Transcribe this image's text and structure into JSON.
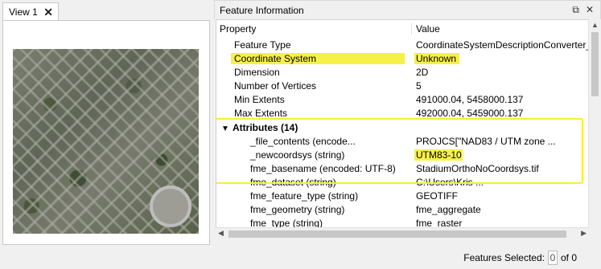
{
  "view": {
    "tab_label": "View 1",
    "close_glyph": "✕"
  },
  "feature_info": {
    "title": "Feature Information",
    "header_buttons": [
      "⧉",
      "✕"
    ],
    "columns": {
      "property": "Property",
      "value": "Value"
    },
    "rows": [
      {
        "property": "Feature Type",
        "value": "CoordinateSystemDescriptionConverter_"
      },
      {
        "property": "Coordinate System",
        "value": "Unknown"
      },
      {
        "property": "Dimension",
        "value": "2D"
      },
      {
        "property": "Number of Vertices",
        "value": "5"
      },
      {
        "property": "Min Extents",
        "value": "491000.04, 5458000.137"
      },
      {
        "property": "Max Extents",
        "value": "492000.04, 5459000.137"
      },
      {
        "property": "Attributes (14)",
        "value": ""
      },
      {
        "property": "_file_contents (encode...",
        "value": "PROJCS[\"NAD83 / UTM zone ..."
      },
      {
        "property": "_newcoordsys (string)",
        "value": "UTM83-10"
      },
      {
        "property": "fme_basename (encoded: UTF-8)",
        "value": "StadiumOrthoNoCoordsys.tif"
      },
      {
        "property": "fme_dataset (string)",
        "value": "C:\\Users\\Kris ..."
      },
      {
        "property": "fme_feature_type (string)",
        "value": "GEOTIFF"
      },
      {
        "property": "fme_geometry (string)",
        "value": "fme_aggregate"
      },
      {
        "property": "fme_type (string)",
        "value": "fme_raster"
      }
    ],
    "expand_glyph": "▼"
  },
  "footer": {
    "label": "Features Selected:",
    "selected": "0",
    "of_total": "of 0"
  },
  "colors": {
    "highlight": "#f6f04a"
  }
}
